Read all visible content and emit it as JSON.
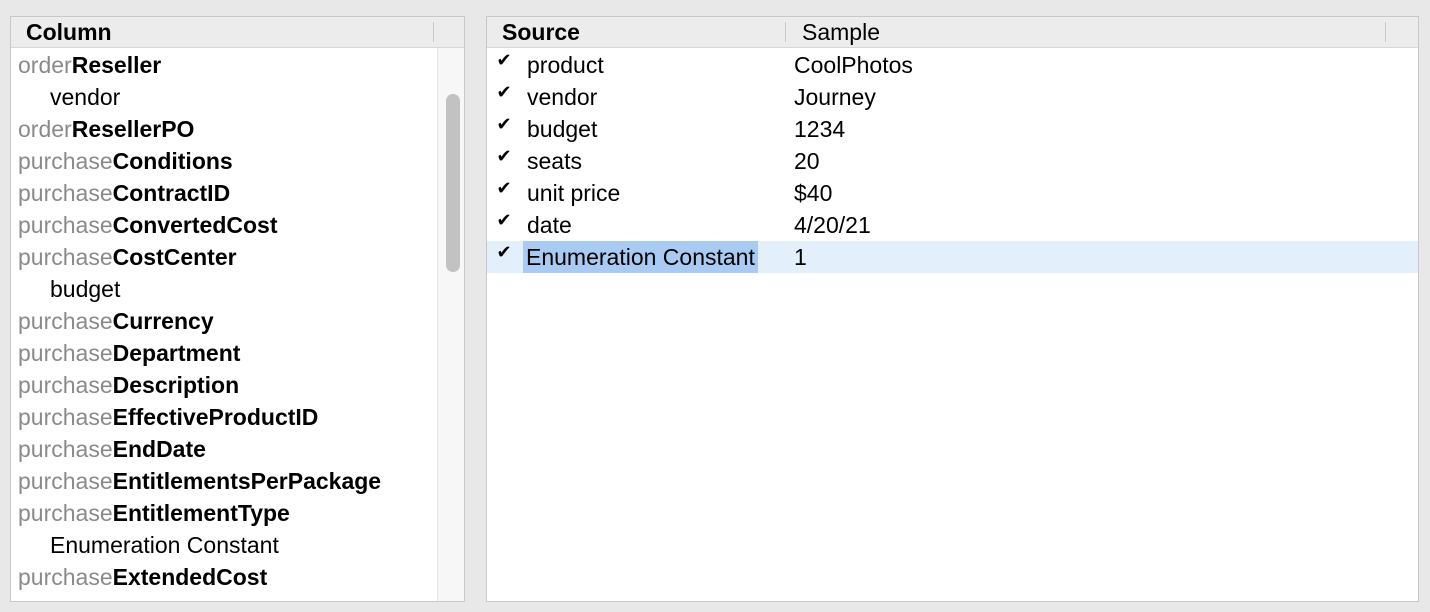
{
  "left": {
    "header": "Column",
    "rows": [
      {
        "prefix": "order",
        "name": "Reseller"
      },
      {
        "child": "vendor"
      },
      {
        "prefix": "order",
        "name": "ResellerPO"
      },
      {
        "prefix": "purchase",
        "name": "Conditions"
      },
      {
        "prefix": "purchase",
        "name": "ContractID"
      },
      {
        "prefix": "purchase",
        "name": "ConvertedCost"
      },
      {
        "prefix": "purchase",
        "name": "CostCenter"
      },
      {
        "child": "budget"
      },
      {
        "prefix": "purchase",
        "name": "Currency"
      },
      {
        "prefix": "purchase",
        "name": "Department"
      },
      {
        "prefix": "purchase",
        "name": "Description"
      },
      {
        "prefix": "purchase",
        "name": "EffectiveProductID"
      },
      {
        "prefix": "purchase",
        "name": "EndDate"
      },
      {
        "prefix": "purchase",
        "name": "EntitlementsPerPackage"
      },
      {
        "prefix": "purchase",
        "name": "EntitlementType"
      },
      {
        "child": "Enumeration Constant"
      },
      {
        "prefix": "purchase",
        "name": "ExtendedCost"
      }
    ]
  },
  "right": {
    "header_source": "Source",
    "header_sample": "Sample",
    "rows": [
      {
        "checked": true,
        "source": "product",
        "sample": "CoolPhotos"
      },
      {
        "checked": true,
        "source": "vendor",
        "sample": "Journey"
      },
      {
        "checked": true,
        "source": "budget",
        "sample": "1234"
      },
      {
        "checked": true,
        "source": "seats",
        "sample": "20"
      },
      {
        "checked": true,
        "source": "unit price",
        "sample": "$40"
      },
      {
        "checked": true,
        "source": "date",
        "sample": "4/20/21"
      },
      {
        "checked": true,
        "source": "Enumeration Constant",
        "sample": "1",
        "selected": true
      }
    ]
  },
  "colors": {
    "selection_row": "#e4effc",
    "selection_cell": "#a9cbf3",
    "prefix_gray": "#8a8a8a"
  },
  "icons": {
    "check": "checkmark-icon"
  }
}
